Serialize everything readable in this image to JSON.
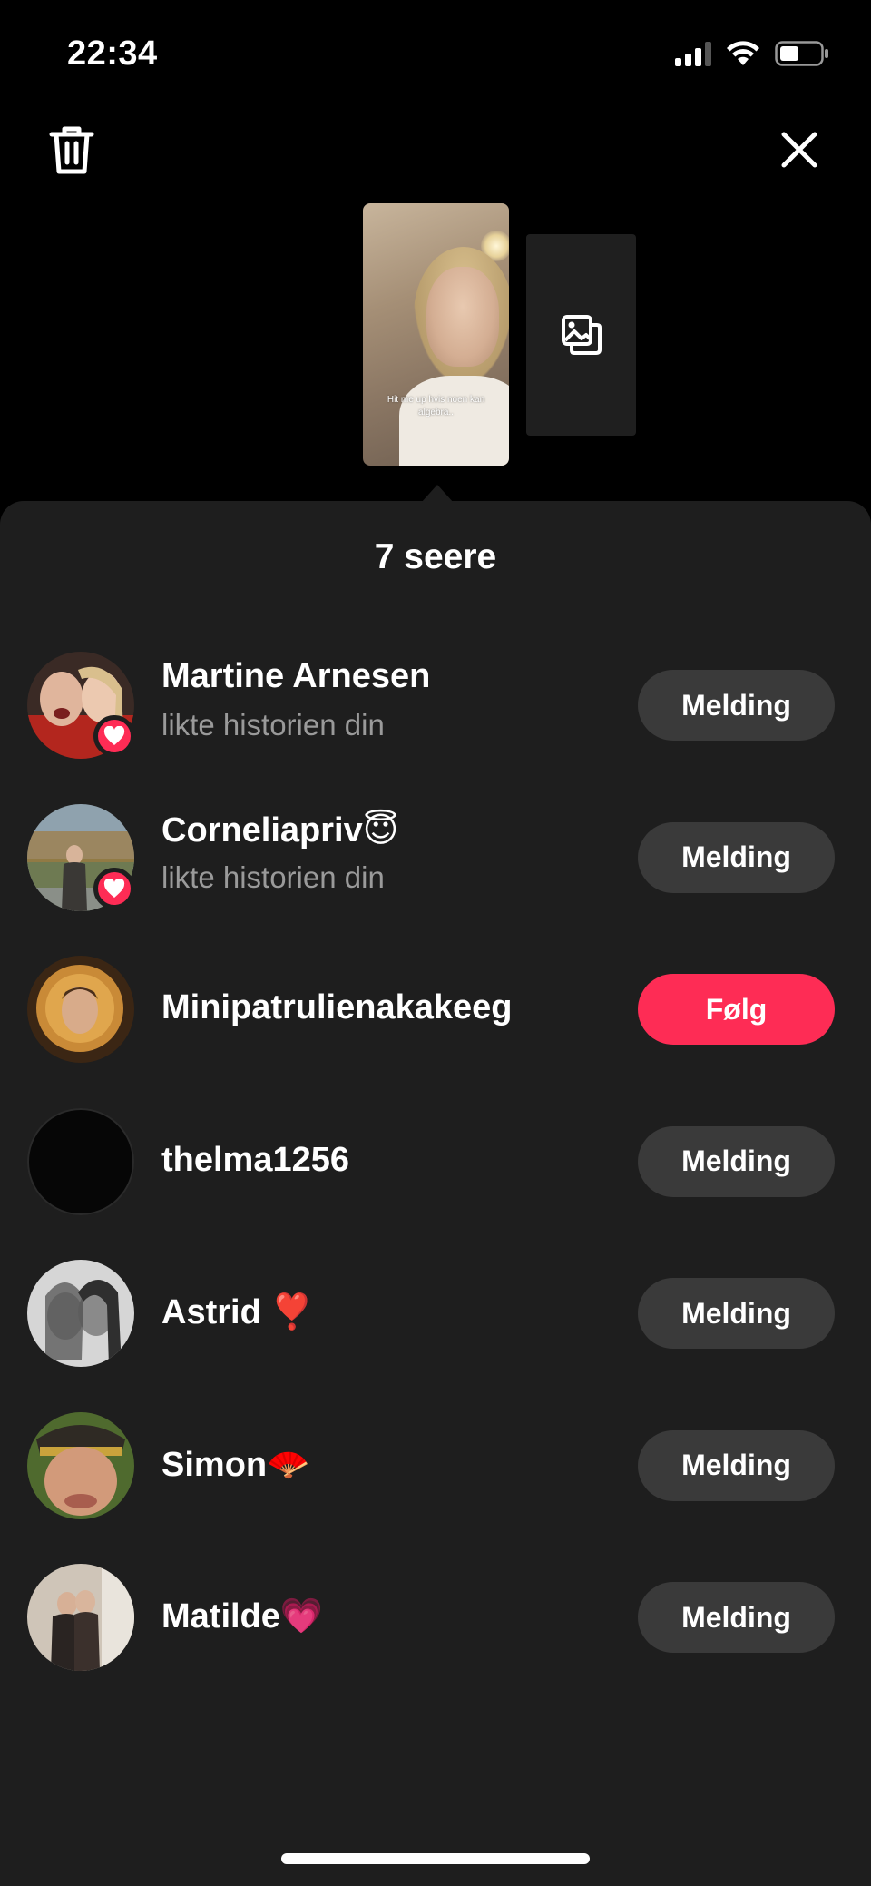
{
  "status_bar": {
    "time": "22:34",
    "icons": [
      "cellular-signal-icon",
      "wifi-icon",
      "battery-icon"
    ]
  },
  "top_bar": {
    "left_icon": "trash-icon",
    "right_icon": "close-icon"
  },
  "story": {
    "caption": "Hit me up hvis noen kan algebra..",
    "add_icon": "add-photo-icon"
  },
  "viewers": {
    "title": "7 seere",
    "items": [
      {
        "name": "Martine Arnesen",
        "subtitle": "likte historien din",
        "liked": true,
        "button": "Melding",
        "button_type": "message"
      },
      {
        "name": "Corneliapriv😇",
        "subtitle": "likte historien din",
        "liked": true,
        "button": "Melding",
        "button_type": "message"
      },
      {
        "name": "Minipatrulienakakeeg",
        "subtitle": "",
        "liked": false,
        "button": "Følg",
        "button_type": "follow"
      },
      {
        "name": "thelma1256",
        "subtitle": "",
        "liked": false,
        "button": "Melding",
        "button_type": "message"
      },
      {
        "name": "Astrid ❣️",
        "subtitle": "",
        "liked": false,
        "button": "Melding",
        "button_type": "message"
      },
      {
        "name": "Simon🪭",
        "subtitle": "",
        "liked": false,
        "button": "Melding",
        "button_type": "message"
      },
      {
        "name": "Matilde💗",
        "subtitle": "",
        "liked": false,
        "button": "Melding",
        "button_type": "message"
      }
    ]
  },
  "colors": {
    "background": "#000000",
    "sheet": "#1e1e1e",
    "accent": "#fe2c55",
    "message_button": "#3a3a3a",
    "secondary_text": "#9a9a9a"
  }
}
